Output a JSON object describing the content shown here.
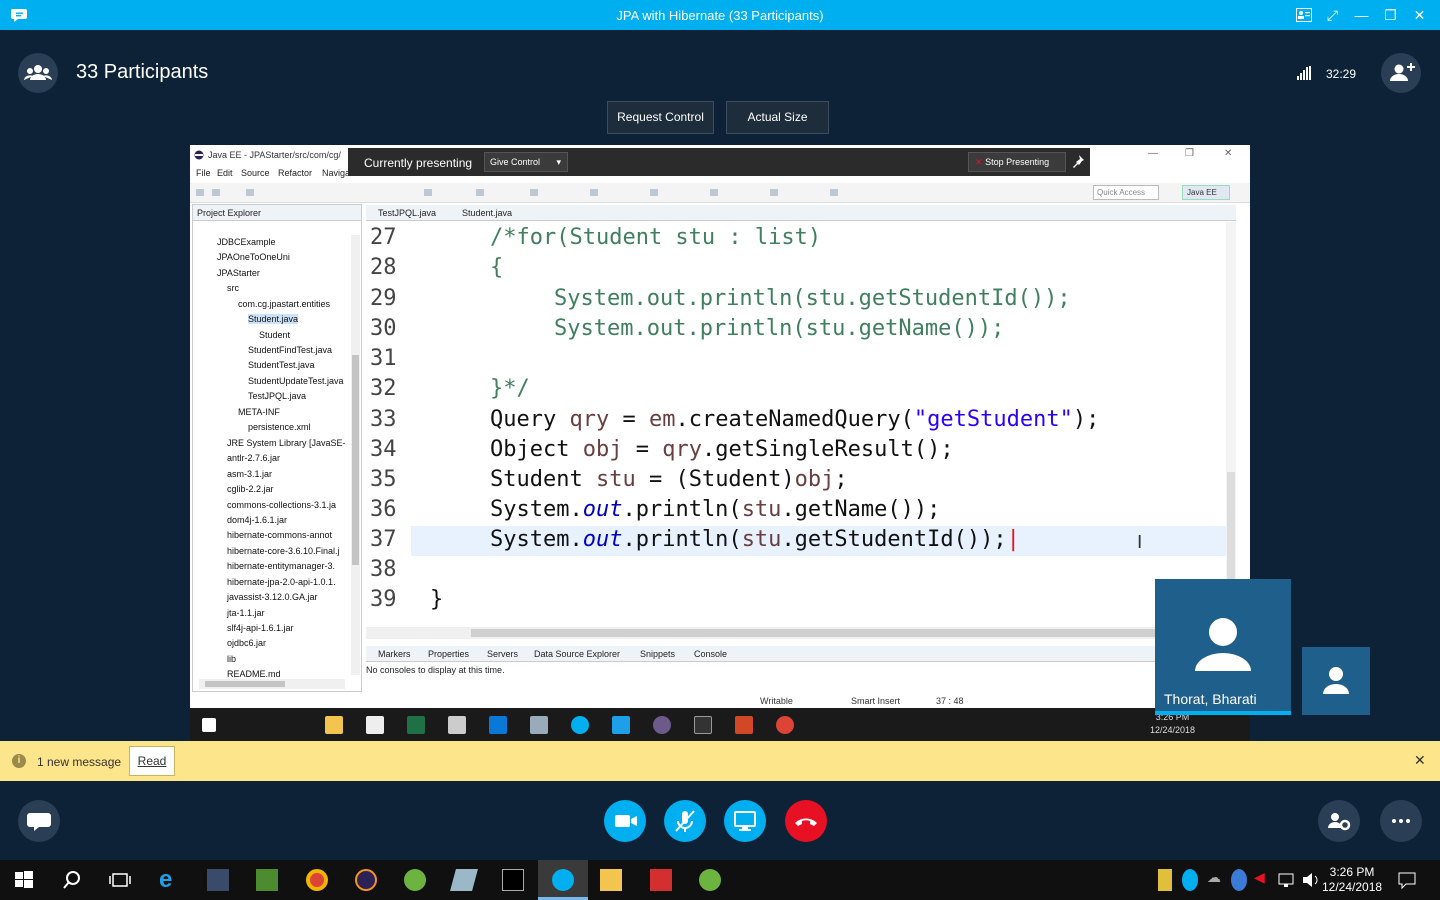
{
  "window": {
    "title": "JPA with Hibernate (33 Participants)"
  },
  "header": {
    "participants_label": "33 Participants",
    "call_time": "32:29",
    "request_control": "Request Control",
    "actual_size": "Actual Size"
  },
  "shared_screen": {
    "eclipse_title": "Java EE - JPAStarter/src/com/cg/",
    "presenting_label": "Currently presenting",
    "give_control": "Give Control",
    "stop_presenting": "Stop Presenting",
    "menu": [
      "File",
      "Edit",
      "Source",
      "Refactor",
      "Navigate"
    ],
    "quick_access": "Quick Access",
    "perspective": "Java EE",
    "project_explorer": {
      "title": "Project Explorer",
      "items": [
        "JDBCExample",
        "JPAOneToOneUni",
        "JPAStarter",
        "src",
        "com.cg.jpastart.entities",
        "Student.java",
        "Student",
        "StudentFindTest.java",
        "StudentTest.java",
        "StudentUpdateTest.java",
        "TestJPQL.java",
        "META-INF",
        "persistence.xml",
        "JRE System Library [JavaSE-",
        "antlr-2.7.6.jar",
        "asm-3.1.jar",
        "cglib-2.2.jar",
        "commons-collections-3.1.ja",
        "dom4j-1.6.1.jar",
        "hibernate-commons-annot",
        "hibernate-core-3.6.10.Final.j",
        "hibernate-entitymanager-3.",
        "hibernate-jpa-2.0-api-1.0.1.",
        "javassist-3.12.0.GA.jar",
        "jta-1.1.jar",
        "slf4j-api-1.6.1.jar",
        "ojdbc6.jar",
        "lib",
        "README.md"
      ]
    },
    "editor_tabs": [
      "TestJPQL.java",
      "Student.java"
    ],
    "line_numbers": [
      "27",
      "28",
      "29",
      "30",
      "31",
      "32",
      "33",
      "34",
      "35",
      "36",
      "37",
      "38",
      "39"
    ],
    "code": {
      "l27": "/*for(Student stu : list)",
      "l28": "{",
      "l29": "System.out.println(stu.getStudentId());",
      "l30": "System.out.println(stu.getName());",
      "l32": "}*/",
      "l33_a": "Query ",
      "l33_b": "qry",
      "l33_c": " = ",
      "l33_d": "em",
      "l33_e": ".createNamedQuery(",
      "l33_f": "\"getStudent\"",
      "l33_g": ");",
      "l34_a": "Object ",
      "l34_b": "obj",
      "l34_c": " = ",
      "l34_d": "qry",
      "l34_e": ".getSingleResult();",
      "l35_a": "Student ",
      "l35_b": "stu",
      "l35_c": " = (Student)",
      "l35_d": "obj",
      "l35_e": ";",
      "l36_a": "System.",
      "l36_b": "out",
      "l36_c": ".println(",
      "l36_d": "stu",
      "l36_e": ".getName());",
      "l37_a": "System.",
      "l37_b": "out",
      "l37_c": ".println(",
      "l37_d": "stu",
      "l37_e": ".getStudentId());",
      "l39": "}"
    },
    "bottom_tabs": [
      "Markers",
      "Properties",
      "Servers",
      "Data Source Explorer",
      "Snippets",
      "Console"
    ],
    "console_message": "No consoles to display at this time.",
    "status": {
      "writable": "Writable",
      "insert_mode": "Smart Insert",
      "position": "37 : 48"
    },
    "inner_clock": {
      "time": "3:26 PM",
      "date": "12/24/2018"
    }
  },
  "video": {
    "presenter_name": "Thorat, Bharati"
  },
  "notification": {
    "message": "1 new message",
    "read_button": "Read"
  },
  "taskbar": {
    "time": "3:26 PM",
    "date": "12/24/2018"
  },
  "colors": {
    "skype_blue": "#00aff0",
    "background": "#0d2237",
    "end_call_red": "#e81123",
    "notification_yellow": "#fce58a"
  }
}
